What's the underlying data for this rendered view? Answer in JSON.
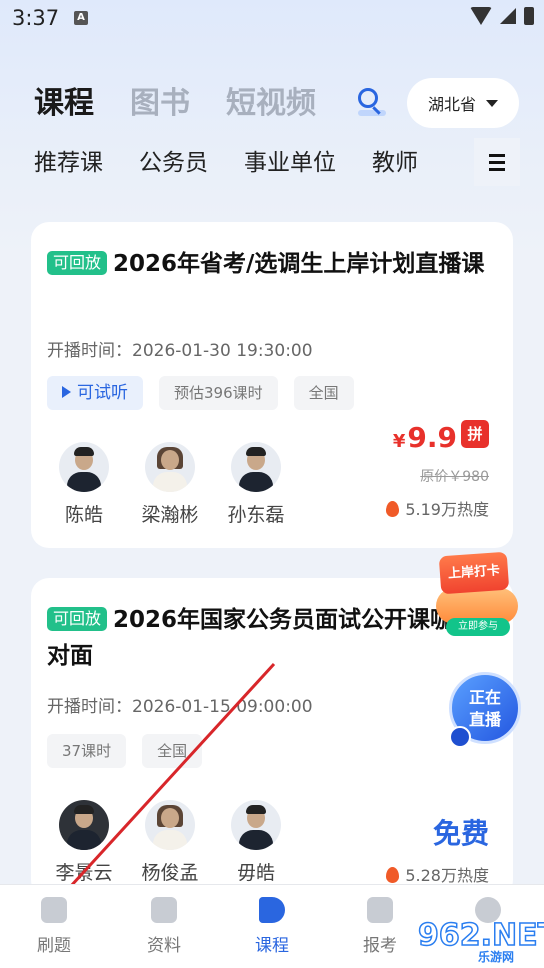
{
  "status_bar": {
    "time": "3:37"
  },
  "top_tabs": [
    "课程",
    "图书",
    "短视频"
  ],
  "region": "湖北省",
  "categories": [
    "推荐课",
    "公务员",
    "事业单位",
    "教师"
  ],
  "courses": [
    {
      "badge": "可回放",
      "title": "2026年省考/选调生上岸计划直播课",
      "time_label": "开播时间：2026-01-30 19:30:00",
      "tags": [
        "可试听",
        "预估396课时",
        "全国"
      ],
      "teachers": [
        "陈皓",
        "梁瀚彬",
        "孙东磊"
      ],
      "price_symbol": "¥",
      "price": "9.9",
      "group_badge": "拼",
      "original_price": "原价￥980",
      "heat": "5.19万热度"
    },
    {
      "badge": "可回放",
      "title": "2026年国家公务员面试公开课咖面对面",
      "time_label": "开播时间：2026-01-15 09:00:00",
      "tags": [
        "37课时",
        "全国"
      ],
      "teachers": [
        "李景云",
        "杨俊孟",
        "毋皓"
      ],
      "price": "免费",
      "heat": "5.28万热度"
    }
  ],
  "floating": {
    "checkin_title": "上岸打卡",
    "checkin_action": "立即参与",
    "live_line1": "正在",
    "live_line2": "直播"
  },
  "bottom_nav": [
    "刷题",
    "资料",
    "课程",
    "报考",
    "我的"
  ],
  "watermark": {
    "main": "962.NET",
    "sub": "乐游网"
  },
  "colors": {
    "accent": "#2a66e0",
    "price_red": "#e8312b",
    "replay_green": "#22c08a",
    "annotation_arrow": "#d8262a"
  }
}
